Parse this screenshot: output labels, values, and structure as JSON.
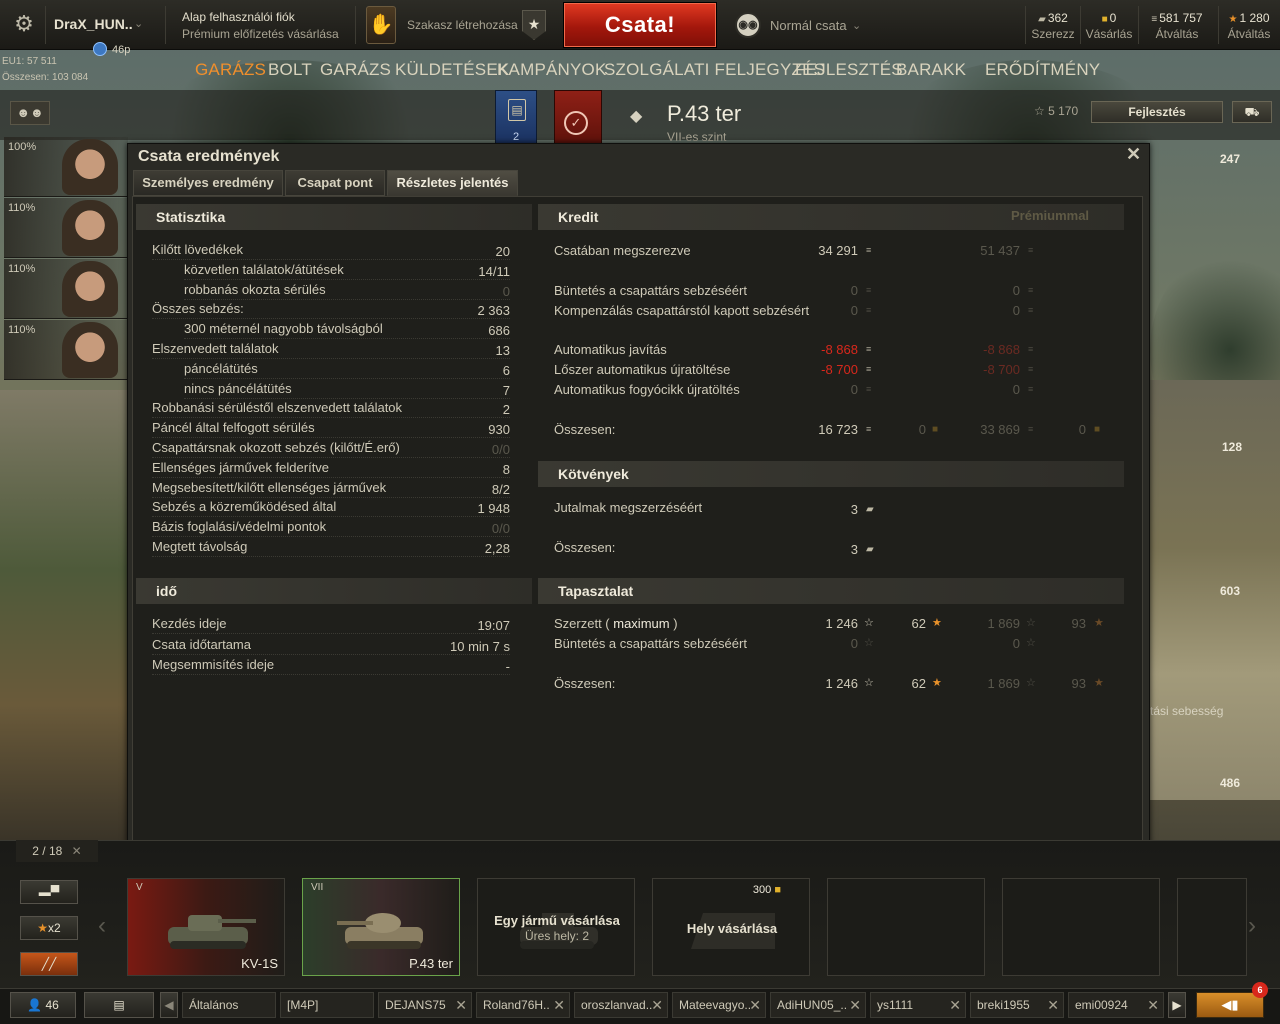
{
  "topbar": {
    "account_name": "DraX_HUN..",
    "level": "46p",
    "premium_line1": "Alap felhasználói fiók",
    "premium_line2": "Prémium előfizetés vásárlása",
    "squad_label": "Szakasz létrehozása",
    "squad_badge": "★",
    "battle_button": "Csata!",
    "mode_label": "Normál csata",
    "currencies": [
      {
        "value": "362",
        "label": "Szerezz",
        "icon": "bonds-icon"
      },
      {
        "value": "0",
        "label": "Vásárlás",
        "icon": "gold-icon"
      },
      {
        "value": "581 757",
        "label": "Átváltás",
        "icon": "credits-icon"
      },
      {
        "value": "1 280",
        "label": "Átváltás",
        "icon": "free-xp-icon"
      }
    ]
  },
  "account_info": {
    "server_line": "EU1: 57 511",
    "total_line": "Összesen: 103 084"
  },
  "nav": [
    "GARÁZS",
    "BOLT",
    "GARÁZS",
    "KÜLDETÉSEK",
    "KAMPÁNYOK",
    "SZOLGÁLATI FELJEGYZÉS",
    "FEJLESZTÉS",
    "BARAKK",
    "ERŐDÍTMÉNY"
  ],
  "vehicle": {
    "name": "P.43 ter",
    "tier_label": "VII-es szint",
    "xp": "5 170",
    "upgrade_button": "Fejlesztés",
    "box1_count": "2"
  },
  "crew": [
    {
      "pct": "100%"
    },
    {
      "pct": "110%"
    },
    {
      "pct": "110%"
    },
    {
      "pct": "110%"
    }
  ],
  "right_values": [
    "247",
    "128",
    "603",
    "486"
  ],
  "right_text": "tási sebesség",
  "dialog": {
    "title": "Csata eredmények",
    "tabs": [
      "Személyes eredmény",
      "Csapat pont",
      "Részletes jelentés"
    ],
    "active_tab": 2,
    "stats": {
      "title": "Statisztika",
      "rows": [
        {
          "label": "Kilőtt lövedékek",
          "value": "20",
          "indent": false,
          "dim": false
        },
        {
          "label": "közvetlen találatok/átütések",
          "value": "14/11",
          "indent": true,
          "dim": false
        },
        {
          "label": "robbanás okozta sérülés",
          "value": "0",
          "indent": true,
          "dim": true
        },
        {
          "label": "Összes sebzés:",
          "value": "2 363",
          "indent": false,
          "dim": false
        },
        {
          "label": "300 méternél nagyobb távolságból",
          "value": "686",
          "indent": true,
          "dim": false
        },
        {
          "label": "Elszenvedett találatok",
          "value": "13",
          "indent": false,
          "dim": false
        },
        {
          "label": "páncélátütés",
          "value": "6",
          "indent": true,
          "dim": false
        },
        {
          "label": "nincs páncélátütés",
          "value": "7",
          "indent": true,
          "dim": false
        },
        {
          "label": "Robbanási sérüléstől elszenvedett találatok",
          "value": "2",
          "indent": false,
          "dim": false
        },
        {
          "label": "Páncél által felfogott sérülés",
          "value": "930",
          "indent": false,
          "dim": false
        },
        {
          "label": "Csapattársnak okozott sebzés (kilőtt/É.erő)",
          "value": "0/0",
          "indent": false,
          "dim": true
        },
        {
          "label": "Ellenséges járművek felderítve",
          "value": "8",
          "indent": false,
          "dim": false
        },
        {
          "label": "Megsebesített/kilőtt ellenséges járművek",
          "value": "8/2",
          "indent": false,
          "dim": false
        },
        {
          "label": "Sebzés a közreműködésed által",
          "value": "1 948",
          "indent": false,
          "dim": false
        },
        {
          "label": "Bázis foglalási/védelmi pontok",
          "value": "0/0",
          "indent": false,
          "dim": true
        },
        {
          "label": "Megtett távolság",
          "value": "2,28",
          "indent": false,
          "dim": false
        }
      ]
    },
    "time": {
      "title": "idő",
      "rows": [
        {
          "label": "Kezdés ideje",
          "value": "19:07"
        },
        {
          "label": "Csata időtartama",
          "value": "10 min 7 s"
        },
        {
          "label": "Megsemmisítés ideje",
          "value": "-"
        }
      ]
    },
    "credit": {
      "title": "Kredit",
      "premium_header": "Prémiummal",
      "rows": [
        {
          "label": "Csatában megszerezve",
          "v1": "34 291",
          "v1s": "",
          "v2": "",
          "v3": "51 437",
          "v3s": "dim",
          "v4": ""
        },
        {
          "label": "Büntetés a csapattárs sebzéséért",
          "v1": "0",
          "v1s": "dim",
          "v2": "",
          "v3": "0",
          "v3s": "dim",
          "v4": ""
        },
        {
          "label": "Kompenzálás csapattárstól kapott sebzésért",
          "v1": "0",
          "v1s": "dim",
          "v2": "",
          "v3": "0",
          "v3s": "dim",
          "v4": ""
        },
        {
          "label": "Automatikus javítás",
          "v1": "-8 868",
          "v1s": "red",
          "v2": "",
          "v3": "-8 868",
          "v3s": "reddim",
          "v4": ""
        },
        {
          "label": "Lőszer automatikus újratöltése",
          "v1": "-8 700",
          "v1s": "red",
          "v2": "",
          "v3": "-8 700",
          "v3s": "reddim",
          "v4": ""
        },
        {
          "label": "Automatikus fogyócikk újratöltés",
          "v1": "0",
          "v1s": "dim",
          "v2": "",
          "v3": "0",
          "v3s": "dim",
          "v4": ""
        },
        {
          "label": "Összesen:",
          "v1": "16 723",
          "v1s": "",
          "v2": "0",
          "v3": "33 869",
          "v3s": "dim",
          "v4": "0"
        }
      ]
    },
    "bonds": {
      "title": "Kötvények",
      "rows": [
        {
          "label": "Jutalmak megszerzéséért",
          "value": "3"
        },
        {
          "label": "Összesen:",
          "value": "3"
        }
      ]
    },
    "experience": {
      "title": "Tapasztalat",
      "rows": [
        {
          "label_a": "Szerzett ( ",
          "label_b": "maximum",
          "label_c": " )",
          "v1": "1 246",
          "v1s": "",
          "v2": "62",
          "v3": "1 869",
          "v4": "93"
        },
        {
          "label_a": "Büntetés a csapattárs sebzéséért",
          "label_b": "",
          "label_c": "",
          "v1": "0",
          "v1s": "dim",
          "v2": "",
          "v3": "0",
          "v4": ""
        },
        {
          "label_a": "Összesen:",
          "label_b": "",
          "label_c": "",
          "v1": "1 246",
          "v1s": "",
          "v2": "62",
          "v3": "1 869",
          "v4": "93"
        }
      ]
    }
  },
  "carousel": {
    "count": "2",
    "count_total": "18",
    "side_buttons": [
      "tank-filter-icon",
      "x2",
      "stripes-icon"
    ],
    "x2_label": "x2",
    "cards": [
      {
        "tier": "V",
        "name": "KV-1S"
      },
      {
        "tier": "VII",
        "name": "P.43 ter"
      }
    ],
    "buy_vehicle": {
      "label": "Egy jármű vásárlása",
      "sub": "Üres hely: 2"
    },
    "buy_slot": {
      "label": "Hely vásárlása",
      "price": "300"
    }
  },
  "bottombar": {
    "players": "46",
    "channels": [
      "Általános",
      "[M4P]",
      "DEJANS75",
      "Roland76H..",
      "oroszlanvad..",
      "Mateevagyo..",
      "AdiHUN05_..",
      "ys1111",
      "breki1955",
      "emi00924"
    ],
    "notification_count": "6"
  }
}
